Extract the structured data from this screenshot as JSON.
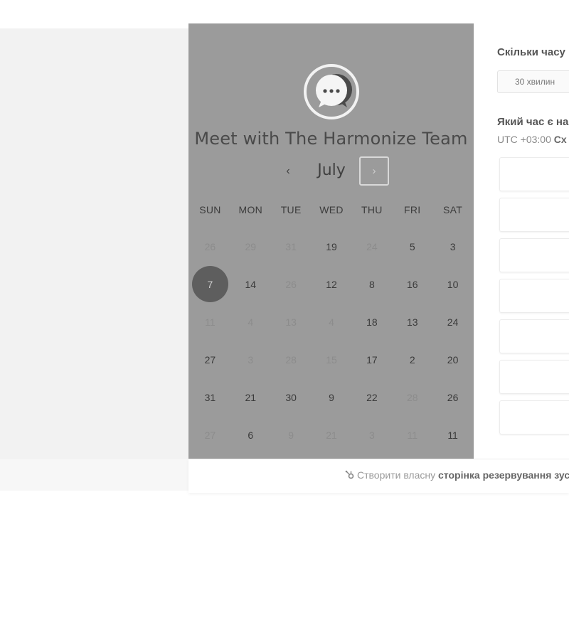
{
  "header": {
    "title": "Meet with The Harmonize Team",
    "logo_icon": "chat-bubble-icon"
  },
  "calendar": {
    "month": "July",
    "prev_icon": "‹",
    "next_icon": "›",
    "weekdays": [
      "SUN",
      "MON",
      "TUE",
      "WED",
      "THU",
      "FRI",
      "SAT"
    ],
    "weeks": [
      [
        {
          "d": "26",
          "m": true
        },
        {
          "d": "29",
          "m": true
        },
        {
          "d": "31",
          "m": true
        },
        {
          "d": "19",
          "m": false
        },
        {
          "d": "24",
          "m": true
        },
        {
          "d": "5",
          "m": false
        },
        {
          "d": "3",
          "m": false
        }
      ],
      [
        {
          "d": "7",
          "m": false,
          "sel": true
        },
        {
          "d": "14",
          "m": false
        },
        {
          "d": "26",
          "m": true
        },
        {
          "d": "12",
          "m": false
        },
        {
          "d": "8",
          "m": false
        },
        {
          "d": "16",
          "m": false
        },
        {
          "d": "10",
          "m": false
        }
      ],
      [
        {
          "d": "11",
          "m": true
        },
        {
          "d": "4",
          "m": true
        },
        {
          "d": "13",
          "m": true
        },
        {
          "d": "4",
          "m": true
        },
        {
          "d": "18",
          "m": false
        },
        {
          "d": "13",
          "m": false
        },
        {
          "d": "24",
          "m": false
        }
      ],
      [
        {
          "d": "27",
          "m": false
        },
        {
          "d": "3",
          "m": true
        },
        {
          "d": "28",
          "m": true
        },
        {
          "d": "15",
          "m": true
        },
        {
          "d": "17",
          "m": false
        },
        {
          "d": "2",
          "m": false
        },
        {
          "d": "20",
          "m": false
        }
      ],
      [
        {
          "d": "31",
          "m": false
        },
        {
          "d": "21",
          "m": false
        },
        {
          "d": "30",
          "m": false
        },
        {
          "d": "9",
          "m": false
        },
        {
          "d": "22",
          "m": false
        },
        {
          "d": "28",
          "m": true
        },
        {
          "d": "26",
          "m": false
        }
      ],
      [
        {
          "d": "27",
          "m": true
        },
        {
          "d": "6",
          "m": false
        },
        {
          "d": "9",
          "m": true
        },
        {
          "d": "21",
          "m": true
        },
        {
          "d": "3",
          "m": true
        },
        {
          "d": "11",
          "m": true
        },
        {
          "d": "11",
          "m": false
        }
      ]
    ]
  },
  "booking": {
    "duration_question": "Скільки часу",
    "duration_value": "30 хвилин",
    "time_question": "Який час є на",
    "timezone_prefix": "UTC +03:00",
    "timezone_name": "Сх",
    "slots": [
      "",
      "",
      "",
      "",
      "",
      "",
      ""
    ]
  },
  "footer": {
    "prefix": "Створити власну",
    "bold": "сторінка резервування зус"
  }
}
